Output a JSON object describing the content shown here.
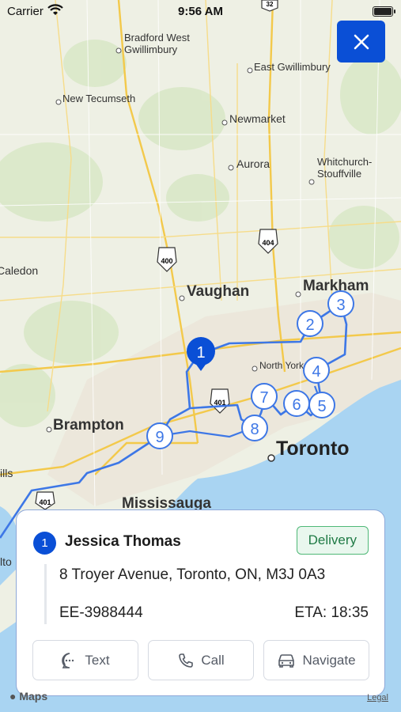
{
  "status_bar": {
    "carrier": "Carrier",
    "time": "9:56 AM"
  },
  "map": {
    "places": [
      {
        "name": "Bradford West"
      },
      {
        "name": "Gwillimbury"
      },
      {
        "name": "East Gwillimbury"
      },
      {
        "name": "New Tecumseth"
      },
      {
        "name": "Newmarket"
      },
      {
        "name": "Aurora"
      },
      {
        "name": "Whitchurch-"
      },
      {
        "name": "Stouffville"
      },
      {
        "name": "Caledon"
      },
      {
        "name": "Vaughan"
      },
      {
        "name": "Markham"
      },
      {
        "name": "North York"
      },
      {
        "name": "Brampton"
      },
      {
        "name": "Toronto"
      },
      {
        "name": "Mississauga"
      },
      {
        "name": "ills"
      },
      {
        "name": "lto"
      }
    ],
    "highway_shields": [
      "400",
      "404",
      "401",
      "401",
      "32"
    ],
    "stops": [
      "1",
      "2",
      "3",
      "4",
      "5",
      "6",
      "7",
      "8",
      "9"
    ],
    "attribution": "Maps",
    "legal": "Legal"
  },
  "close_button": {
    "icon": "close-icon"
  },
  "stop_card": {
    "stop_number": "1",
    "customer_name": "Jessica Thomas",
    "badge": "Delivery",
    "address": "8 Troyer Avenue, Toronto, ON, M3J 0A3",
    "order_id": "EE-3988444",
    "eta": "ETA: 18:35",
    "actions": {
      "text": "Text",
      "call": "Call",
      "navigate": "Navigate"
    }
  },
  "colors": {
    "accent": "#0a4fd6",
    "route": "#3d77e6",
    "delivery_green": "#4fb877",
    "water": "#a9d4f2"
  }
}
